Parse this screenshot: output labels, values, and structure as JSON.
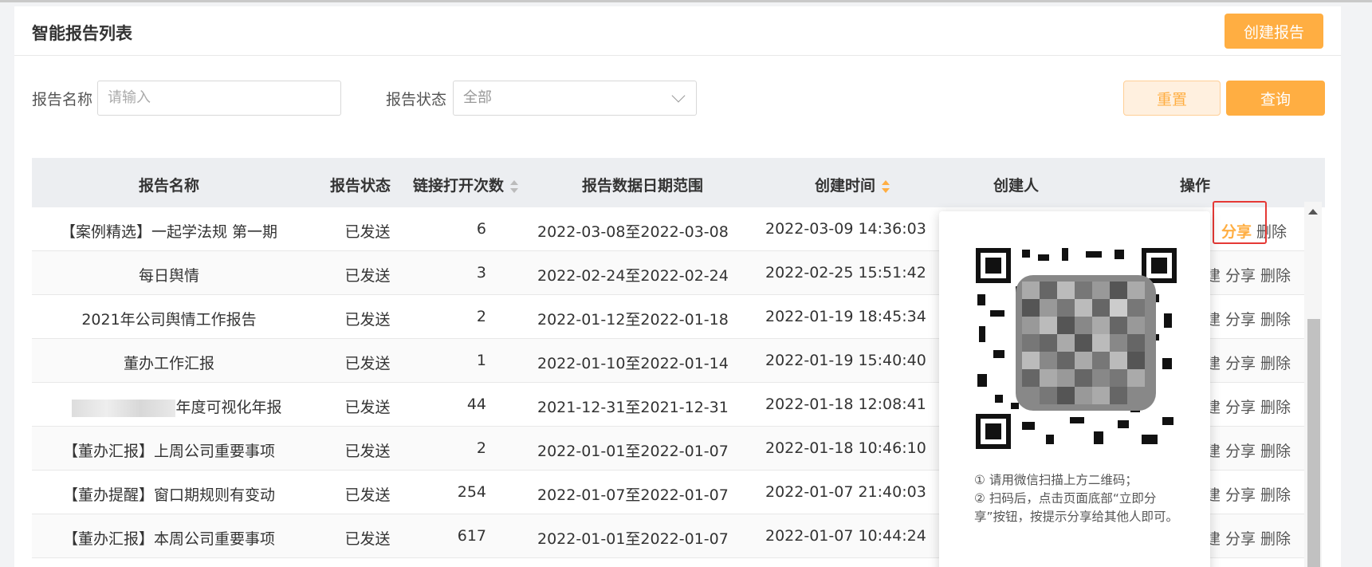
{
  "header": {
    "title": "智能报告列表",
    "create_label": "创建报告"
  },
  "filters": {
    "name_label": "报告名称",
    "name_placeholder": "请输入",
    "status_label": "报告状态",
    "status_value": "全部",
    "reset_label": "重置",
    "query_label": "查询"
  },
  "table": {
    "columns": [
      "报告名称",
      "报告状态",
      "链接打开次数",
      "报告数据日期范围",
      "创建时间",
      "创建人",
      "操作"
    ],
    "rows": [
      {
        "name": "【案例精选】一起学法规 第一期",
        "status": "已发送",
        "count": "6",
        "range": "2022-03-08至2022-03-08",
        "time": "2022-03-09 14:36:03"
      },
      {
        "name": "每日舆情",
        "status": "已发送",
        "count": "3",
        "range": "2022-02-24至2022-02-24",
        "time": "2022-02-25 15:51:42"
      },
      {
        "name": "2021年公司舆情工作报告",
        "status": "已发送",
        "count": "2",
        "range": "2022-01-12至2022-01-18",
        "time": "2022-01-19 18:45:34"
      },
      {
        "name": "董办工作汇报",
        "status": "已发送",
        "count": "1",
        "range": "2022-01-10至2022-01-14",
        "time": "2022-01-19 15:40:40"
      },
      {
        "name": "年度可视化年报",
        "status": "已发送",
        "count": "44",
        "range": "2021-12-31至2021-12-31",
        "time": "2022-01-18 12:08:41"
      },
      {
        "name": "【董办汇报】上周公司重要事项",
        "status": "已发送",
        "count": "2",
        "range": "2022-01-01至2022-01-07",
        "time": "2022-01-18 10:46:10"
      },
      {
        "name": "【董办提醒】窗口期规则有变动",
        "status": "已发送",
        "count": "254",
        "range": "2022-01-07至2022-01-07",
        "time": "2022-01-07 21:40:03"
      },
      {
        "name": "【董办汇报】本周公司重要事项",
        "status": "已发送",
        "count": "617",
        "range": "2022-01-01至2022-01-07",
        "time": "2022-01-07 10:44:24"
      }
    ],
    "ops": {
      "edit_partial": "建",
      "share": "分享",
      "delete": "删除"
    }
  },
  "popover": {
    "tip1": "① 请用微信扫描上方二维码；",
    "tip2": "② 扫码后，点击页面底部“立即分享”按钮，按提示分享给其他人即可。"
  },
  "colors": {
    "accent": "#ffae42",
    "highlight": "#e53935"
  }
}
